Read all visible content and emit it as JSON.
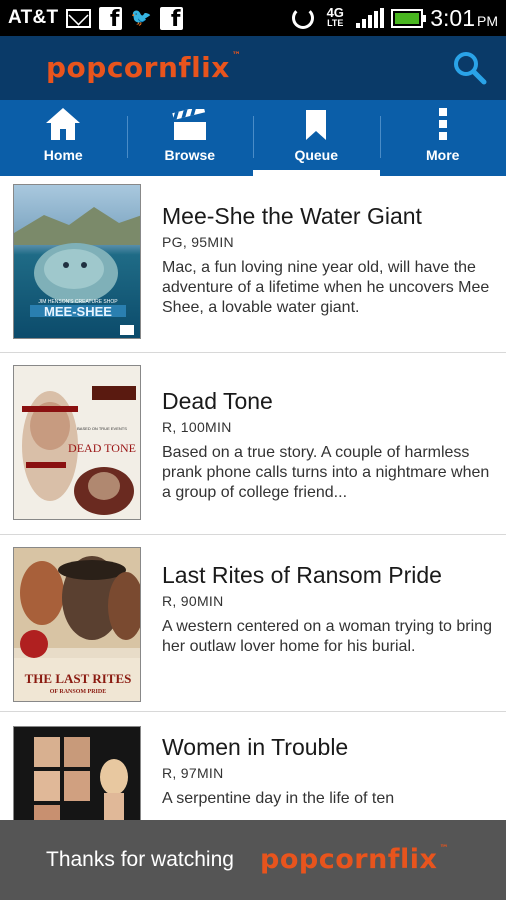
{
  "status_bar": {
    "carrier": "AT&T",
    "network": "4G",
    "network_sub": "LTE",
    "time": "3:01",
    "ampm": "PM",
    "icons": [
      "mail-icon",
      "facebook-icon",
      "twitter-icon",
      "facebook-icon",
      "sync-icon",
      "signal-icon",
      "battery-icon"
    ]
  },
  "header": {
    "logo": "popcornflix",
    "logo_tm": "™",
    "search_icon": "search-icon"
  },
  "tabs": [
    {
      "label": "Home",
      "icon": "home-icon",
      "active": false
    },
    {
      "label": "Browse",
      "icon": "clapperboard-icon",
      "active": false
    },
    {
      "label": "Queue",
      "icon": "bookmark-icon",
      "active": true
    },
    {
      "label": "More",
      "icon": "overflow-menu-icon",
      "active": false
    }
  ],
  "movies": [
    {
      "title": "Mee-She the Water Giant",
      "meta": "PG, 95MIN",
      "description": "Mac, a fun loving nine year old, will have the adventure of a lifetime when he uncovers Mee Shee, a lovable water giant.",
      "poster_text": "MEE-SHEE",
      "poster_sub": "JIM HENSON'S CREATURE SHOP"
    },
    {
      "title": "Dead Tone",
      "meta": "R, 100MIN",
      "description": "Based on a true story. A couple of harmless prank phone calls turns into a nightmare when a group of college friend...",
      "poster_text": "DEAD TONE",
      "poster_sub": "BASED ON TRUE EVENTS"
    },
    {
      "title": "Last Rites of Ransom Pride",
      "meta": "R, 90MIN",
      "description": "A western centered on a woman trying to bring her outlaw lover home for his burial.",
      "poster_text": "THE LAST RITES",
      "poster_sub": "OF RANSOM PRIDE"
    },
    {
      "title": "Women in Trouble",
      "meta": "R, 97MIN",
      "description": "A serpentine day in the life of ten",
      "poster_text": "",
      "poster_sub": ""
    }
  ],
  "footer": {
    "text": "Thanks for watching",
    "logo": "popcornflix",
    "logo_tm": "™"
  },
  "colors": {
    "header_bg": "#0a3a68",
    "tab_bg": "#0b5ea8",
    "brand_orange": "#e8541d",
    "footer_bg": "#555555"
  }
}
